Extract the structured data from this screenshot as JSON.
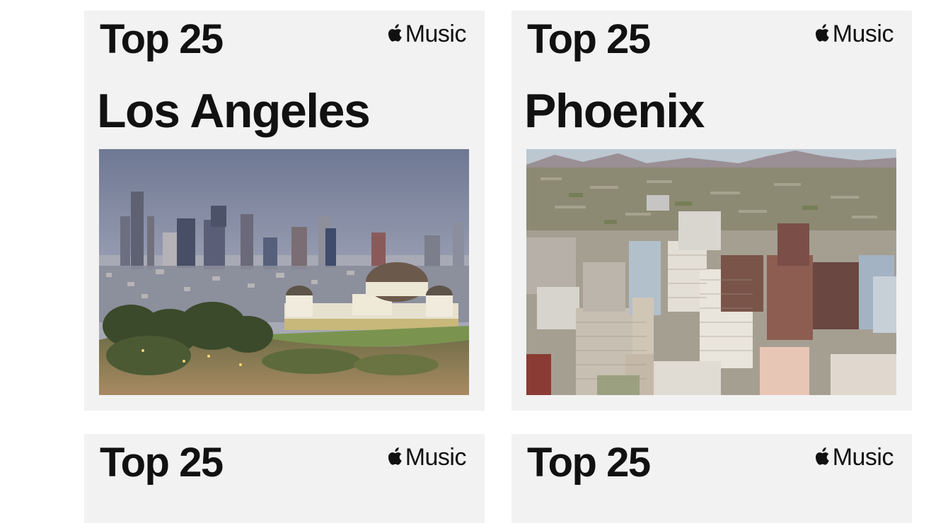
{
  "cards": [
    {
      "heading": "Top 25",
      "brand": "Music",
      "city": "Los Angeles",
      "image": "los-angeles-skyline-with-griffith-observatory"
    },
    {
      "heading": "Top 25",
      "brand": "Music",
      "city": "Phoenix",
      "image": "phoenix-downtown-aerial-with-mountains"
    },
    {
      "heading": "Top 25",
      "brand": "Music",
      "city": "",
      "image": ""
    },
    {
      "heading": "Top 25",
      "brand": "Music",
      "city": "",
      "image": ""
    }
  ],
  "icons": {
    "brand_logo": "apple-icon"
  },
  "colors": {
    "card_bg": "#f2f2f2",
    "text": "#111111"
  }
}
